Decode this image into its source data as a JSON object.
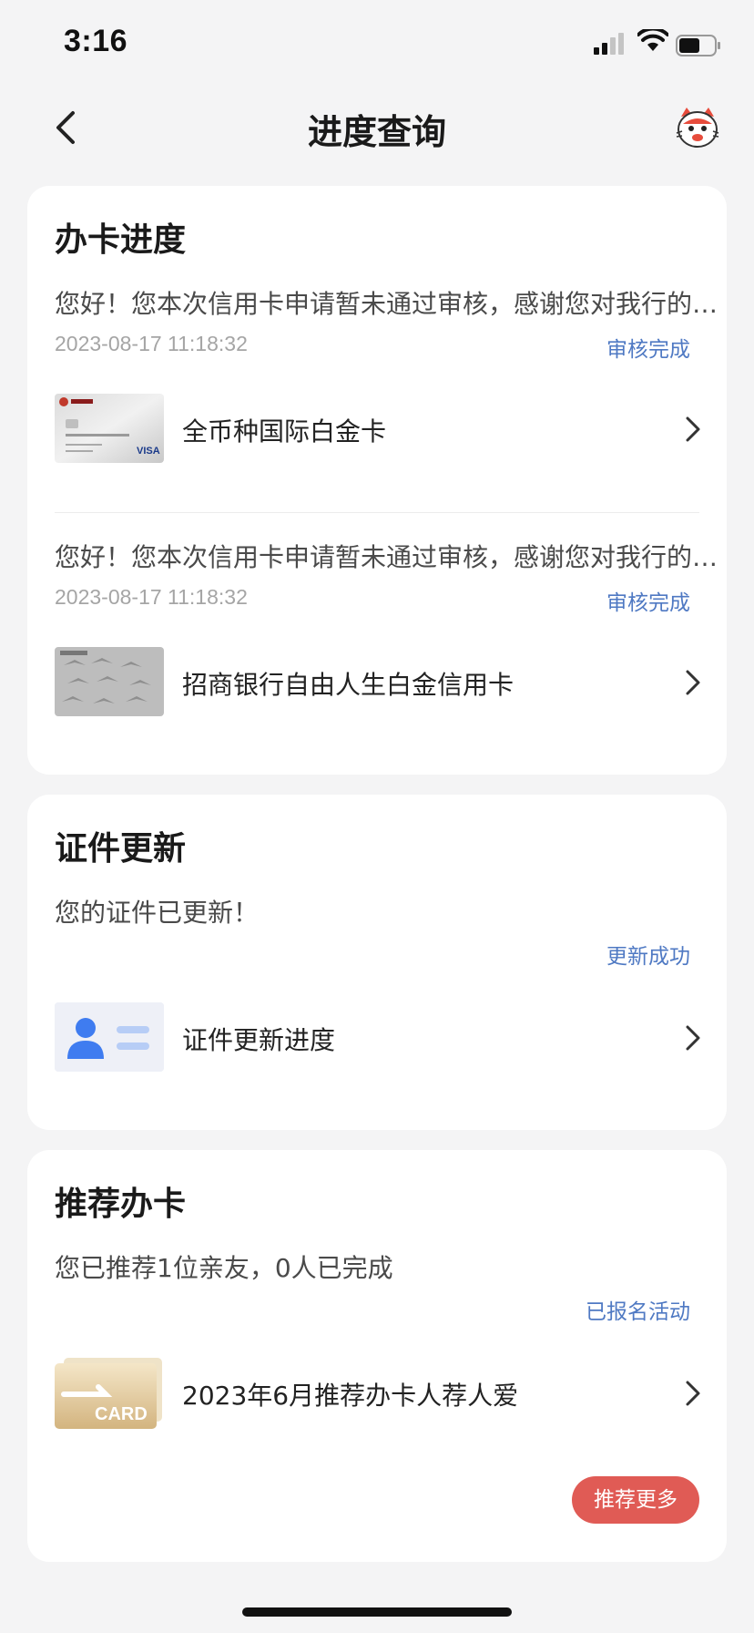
{
  "status_bar": {
    "time": "3:16"
  },
  "nav": {
    "title": "进度查询"
  },
  "card_progress": {
    "title": "办卡进度",
    "applications": [
      {
        "message": "您好！您本次信用卡申请暂未通过审核，感谢您对我行的支持与关注",
        "date": "2023-08-17 11:18:32",
        "status": "审核完成",
        "card_name": "全币种国际白金卡"
      },
      {
        "message": "您好！您本次信用卡申请暂未通过审核，感谢您对我行的支持与关注",
        "date": "2023-08-17 11:18:32",
        "status": "审核完成",
        "card_name": "招商银行自由人生白金信用卡"
      }
    ]
  },
  "card_id_update": {
    "title": "证件更新",
    "message": "您的证件已更新！",
    "status": "更新成功",
    "item_label": "证件更新进度"
  },
  "card_referral": {
    "title": "推荐办卡",
    "message": "您已推荐1位亲友，0人已完成",
    "status": "已报名活动",
    "item_label": "2023年6月推荐办卡人荐人爱",
    "thumb_text": "CARD",
    "more_button": "推荐更多"
  },
  "colors": {
    "status_blue": "#4f79c3",
    "button_red": "#e05b55",
    "background": "#f4f4f5"
  },
  "icons": [
    "back-icon",
    "mascot-icon",
    "chevron-right-icon",
    "id-card-icon"
  ]
}
